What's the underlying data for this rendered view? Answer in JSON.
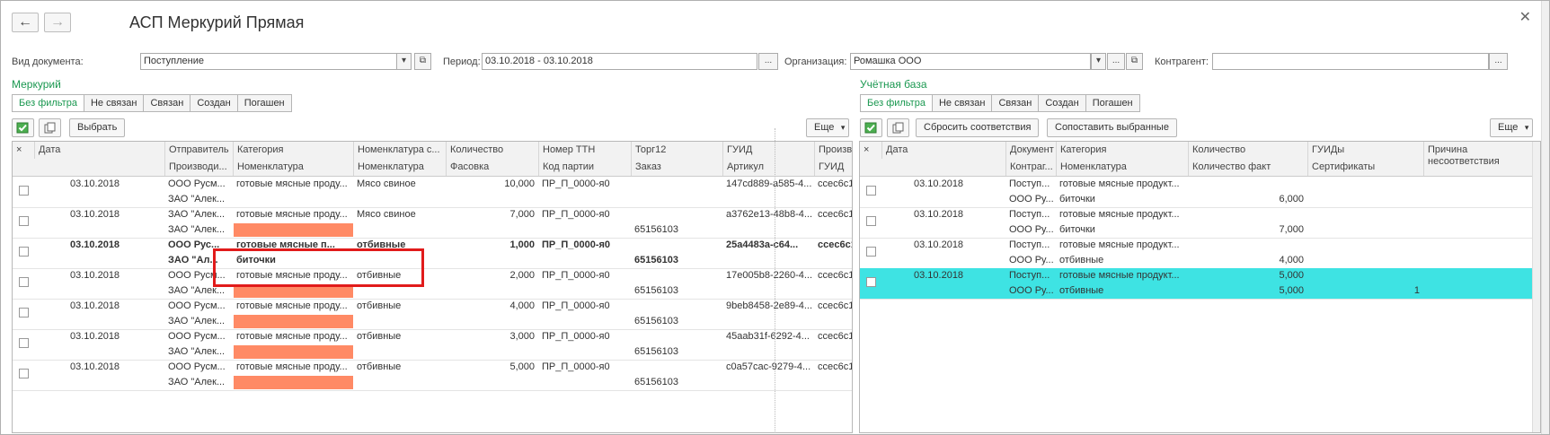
{
  "window": {
    "title": "АСП Меркурий Прямая"
  },
  "filters": {
    "doc_type_label": "Вид документа:",
    "doc_type_value": "Поступление",
    "period_label": "Период:",
    "period_value": "03.10.2018 - 03.10.2018",
    "org_label": "Организация:",
    "org_value": "Ромашка ООО",
    "contragent_label": "Контрагент:",
    "contragent_value": "",
    "ellipsis": "..."
  },
  "left": {
    "section_title": "Меркурий",
    "tabs": [
      "Без фильтра",
      "Не связан",
      "Связан",
      "Создан",
      "Погашен"
    ],
    "select_button": "Выбрать",
    "more_button": "Еще",
    "header_top": [
      "Дата",
      "Отправитель",
      "Категория",
      "Номенклатура с...",
      "Количество",
      "Номер ТТН",
      "Торг12",
      "ГУИД",
      "Производ..."
    ],
    "header_bottom": [
      "Производи...",
      "Номенклатура",
      "Номенклатура",
      "Фасовка",
      "Код партии",
      "Заказ",
      "Артикул",
      "ГУИД"
    ],
    "rows": [
      {
        "date": "03.10.2018",
        "sender": "ООО Русм...",
        "category": "готовые мясные проду...",
        "nomen": "Мясо свиное",
        "qty": "10,000",
        "ttn": "ПР_П_0000-я0",
        "guid": "147cd889-a585-4...",
        "prod": "ccec6c13",
        "sender2": "ЗАО \"Алек...",
        "nomen2": "",
        "order": "",
        "bold": false
      },
      {
        "date": "03.10.2018",
        "sender": "ЗАО \"Алек...",
        "category": "готовые мясные проду...",
        "nomen": "Мясо свиное",
        "qty": "7,000",
        "ttn": "ПР_П_0000-я0",
        "guid": "a3762e13-48b8-4...",
        "prod": "ccec6c13",
        "sender2": "ЗАО \"Алек...",
        "nomen2": "",
        "order": "65156103",
        "bold": false
      },
      {
        "date": "03.10.2018",
        "sender": "ООО Рус...",
        "category": "готовые мясные п...",
        "nomen": "отбивные",
        "qty": "1,000",
        "ttn": "ПР_П_0000-я0",
        "guid": "25a4483a-c64...",
        "prod": "ccec6c1",
        "sender2": "ЗАО \"Ал...",
        "nomen2": "биточки",
        "order": "65156103",
        "bold": true
      },
      {
        "date": "03.10.2018",
        "sender": "ООО Русм...",
        "category": "готовые мясные проду...",
        "nomen": "отбивные",
        "qty": "2,000",
        "ttn": "ПР_П_0000-я0",
        "guid": "17e005b8-2260-4...",
        "prod": "ccec6c13",
        "sender2": "ЗАО \"Алек...",
        "nomen2": "",
        "order": "65156103",
        "bold": false
      },
      {
        "date": "03.10.2018",
        "sender": "ООО Русм...",
        "category": "готовые мясные проду...",
        "nomen": "отбивные",
        "qty": "4,000",
        "ttn": "ПР_П_0000-я0",
        "guid": "9beb8458-2e89-4...",
        "prod": "ccec6c13",
        "sender2": "ЗАО \"Алек...",
        "nomen2": "",
        "order": "65156103",
        "bold": false
      },
      {
        "date": "03.10.2018",
        "sender": "ООО Русм...",
        "category": "готовые мясные проду...",
        "nomen": "отбивные",
        "qty": "3,000",
        "ttn": "ПР_П_0000-я0",
        "guid": "45aab31f-6292-4...",
        "prod": "ccec6c13",
        "sender2": "ЗАО \"Алек...",
        "nomen2": "",
        "order": "65156103",
        "bold": false
      },
      {
        "date": "03.10.2018",
        "sender": "ООО Русм...",
        "category": "готовые мясные проду...",
        "nomen": "отбивные",
        "qty": "5,000",
        "ttn": "ПР_П_0000-я0",
        "guid": "c0a57cac-9279-4...",
        "prod": "ccec6c13",
        "sender2": "ЗАО \"Алек...",
        "nomen2": "",
        "order": "65156103",
        "bold": false
      }
    ]
  },
  "right": {
    "section_title": "Учётная база",
    "tabs": [
      "Без фильтра",
      "Не связан",
      "Связан",
      "Создан",
      "Погашен"
    ],
    "reset_button": "Сбросить соответствия",
    "match_button": "Сопоставить выбранные",
    "more_button": "Еще",
    "header_top": [
      "Дата",
      "Документ",
      "Категория",
      "Количество",
      "ГУИДы",
      "Причина несоответствия"
    ],
    "header_bottom": [
      "Контраг...",
      "Номенклатура",
      "Количество факт",
      "Сертификаты"
    ],
    "rows": [
      {
        "date": "03.10.2018",
        "doc": "Поступ...",
        "category": "готовые мясные продукт...",
        "qty": "",
        "contr": "ООО Ру...",
        "nomen": "биточки",
        "qtyf": "6,000",
        "cert": ""
      },
      {
        "date": "03.10.2018",
        "doc": "Поступ...",
        "category": "готовые мясные продукт...",
        "qty": "",
        "contr": "ООО Ру...",
        "nomen": "биточки",
        "qtyf": "7,000",
        "cert": ""
      },
      {
        "date": "03.10.2018",
        "doc": "Поступ...",
        "category": "готовые мясные продукт...",
        "qty": "",
        "contr": "ООО Ру...",
        "nomen": "отбивные",
        "qtyf": "4,000",
        "cert": ""
      },
      {
        "date": "03.10.2018",
        "doc": "Поступ...",
        "category": "готовые мясные продукт...",
        "qty": "5,000",
        "contr": "ООО Ру...",
        "nomen": "отбивные",
        "qtyf": "5,000",
        "cert": "1"
      }
    ]
  },
  "colors": {
    "accent": "#1a9850",
    "selected_row": "#3ee3e3",
    "highlight": "#ff8a65",
    "annotation": "#e11b1b"
  }
}
